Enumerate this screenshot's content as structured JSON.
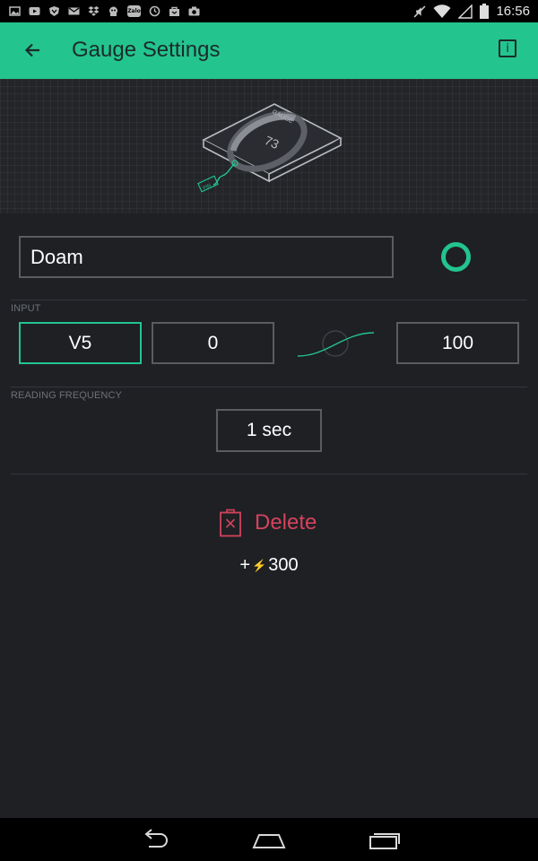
{
  "status_bar": {
    "time": "16:56",
    "icons": [
      "gallery-icon",
      "youtube-icon",
      "shield-icon",
      "gmail-icon",
      "dropbox-icon",
      "game-icon",
      "zalo-icon",
      "clock-icon",
      "bag-icon",
      "camera-icon",
      "mute-icon",
      "wifi-icon",
      "signal-icon",
      "battery-icon"
    ],
    "notif_zalo_text": "Zalo"
  },
  "app_bar": {
    "title": "Gauge Settings",
    "info_label": "i"
  },
  "hero": {
    "gauge_label": "GAUGE",
    "gauge_value": "73",
    "pin_label": "PIN"
  },
  "name_field": {
    "value": "Doam"
  },
  "colors": {
    "accent": "#23c48e",
    "delete": "#d3435c",
    "background": "#1e2024",
    "border": "#5a5c60"
  },
  "input_section": {
    "label": "INPUT",
    "pin": "V5",
    "min": "0",
    "max": "100"
  },
  "frequency_section": {
    "label": "READING FREQUENCY",
    "value": "1 sec"
  },
  "delete": {
    "label": "Delete"
  },
  "cost": {
    "prefix": "+",
    "bolt": "⚡",
    "value": "300"
  },
  "nav": {
    "icons": [
      "back-nav-icon",
      "home-nav-icon",
      "recents-nav-icon"
    ]
  }
}
